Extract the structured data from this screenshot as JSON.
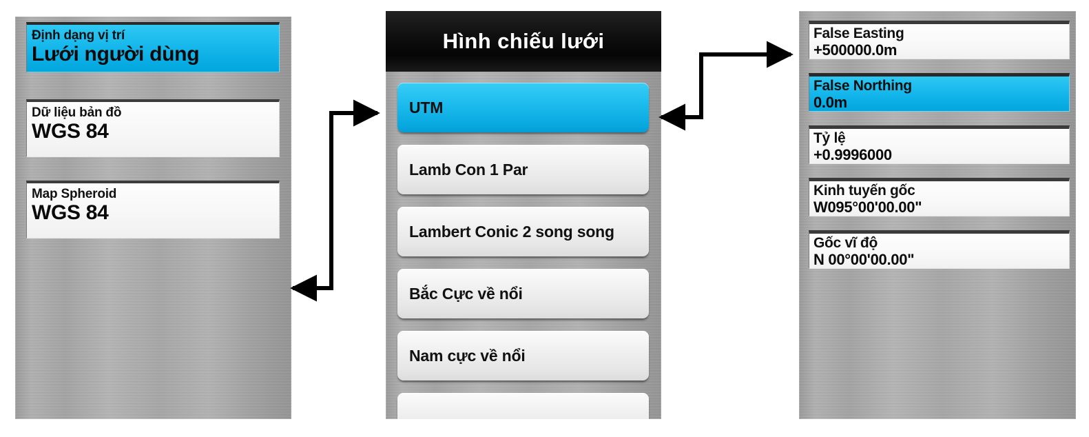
{
  "location_panel": {
    "name": "Location format panel",
    "fields": [
      {
        "label": "Định dạng vị trí",
        "value": "Lưới người dùng",
        "selected": true
      },
      {
        "label": "Dữ liệu bản đồ",
        "value": "WGS 84",
        "selected": false
      },
      {
        "label": "Map Spheroid",
        "value": "WGS 84",
        "selected": false
      }
    ]
  },
  "projection_panel": {
    "header_title": "Hình chiếu lưới",
    "items": [
      {
        "label": "UTM",
        "selected": true
      },
      {
        "label": "Lamb Con 1 Par",
        "selected": false
      },
      {
        "label": "Lambert Conic 2 song song",
        "selected": false
      },
      {
        "label": "Bắc Cực về nổi",
        "selected": false
      },
      {
        "label": "Nam cực về nổi",
        "selected": false
      },
      {
        "label": "",
        "selected": false
      }
    ]
  },
  "params_panel": {
    "fields": [
      {
        "label": "False Easting",
        "value": "+500000.0m",
        "selected": false
      },
      {
        "label": "False Northing",
        "value": "0.0m",
        "selected": true
      },
      {
        "label": "Tỷ lệ",
        "value": "+0.9996000",
        "selected": false
      },
      {
        "label": "Kinh tuyến gốc",
        "value": "W095°00'00.00\"",
        "selected": false
      },
      {
        "label": "Gốc vĩ độ",
        "value": "N 00°00'00.00\"",
        "selected": false
      }
    ]
  },
  "colors": {
    "accent_cyan_top": "#2fc8f2",
    "accent_cyan_bottom": "#01a6dd",
    "panel_metal": "#a8a8a8",
    "header_black": "#0a0a0a",
    "arrow_black": "#000000"
  }
}
